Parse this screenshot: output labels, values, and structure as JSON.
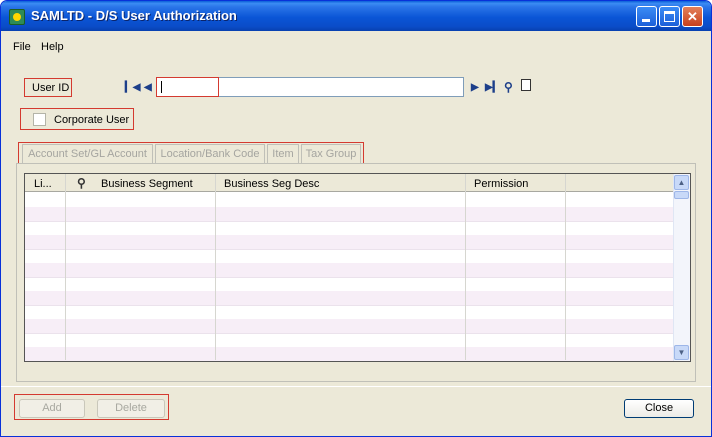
{
  "window": {
    "title": "SAMLTD - D/S User Authorization"
  },
  "menu": {
    "items": [
      "File",
      "Help"
    ]
  },
  "form": {
    "user_id_label": "User ID",
    "user_id_value": "",
    "corporate_user_label": "Corporate User",
    "corporate_user_checked": false
  },
  "tabs": [
    "Account Set/GL Account",
    "Location/Bank Code",
    "Item",
    "Tax Group"
  ],
  "grid": {
    "columns": [
      "Li...",
      "Business Segment",
      "Business Seg Desc",
      "Permission"
    ],
    "rows": []
  },
  "buttons": {
    "add": "Add",
    "delete": "Delete",
    "close": "Close"
  },
  "colors": {
    "highlight_box": "#d43a30",
    "row_stripe": "#f7eef7",
    "title_bar": "#0a55d6"
  }
}
